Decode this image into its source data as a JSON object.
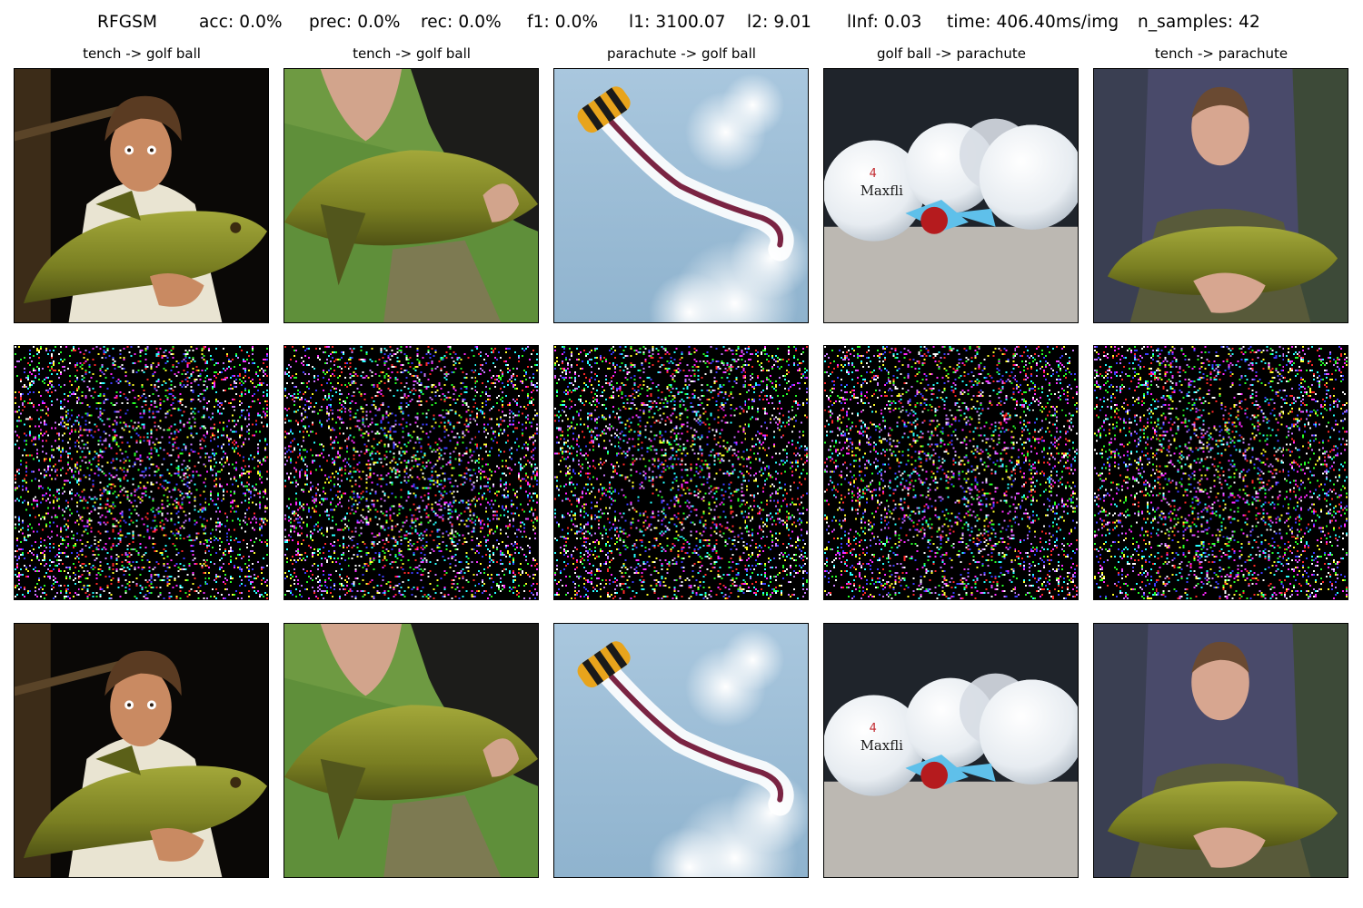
{
  "header": {
    "method": "RFGSM",
    "acc": "acc: 0.0%",
    "prec": "prec: 0.0%",
    "rec": "rec: 0.0%",
    "f1": "f1: 0.0%",
    "l1": "l1: 3100.07",
    "l2": "l2: 9.01",
    "linf": "lInf: 0.03",
    "time": "time: 406.40ms/img",
    "n_samples": "n_samples: 42"
  },
  "columns": [
    {
      "title": "tench -> golf ball",
      "subject": "man-holding-tench"
    },
    {
      "title": "tench -> golf ball",
      "subject": "hands-holding-tench"
    },
    {
      "title": "parachute -> golf ball",
      "subject": "parachute-with-smoke"
    },
    {
      "title": "golf ball -> parachute",
      "subject": "golf-balls-with-tees"
    },
    {
      "title": "tench -> parachute",
      "subject": "soldier-holding-tench"
    }
  ],
  "rows": [
    "original",
    "perturbation",
    "adversarial"
  ]
}
